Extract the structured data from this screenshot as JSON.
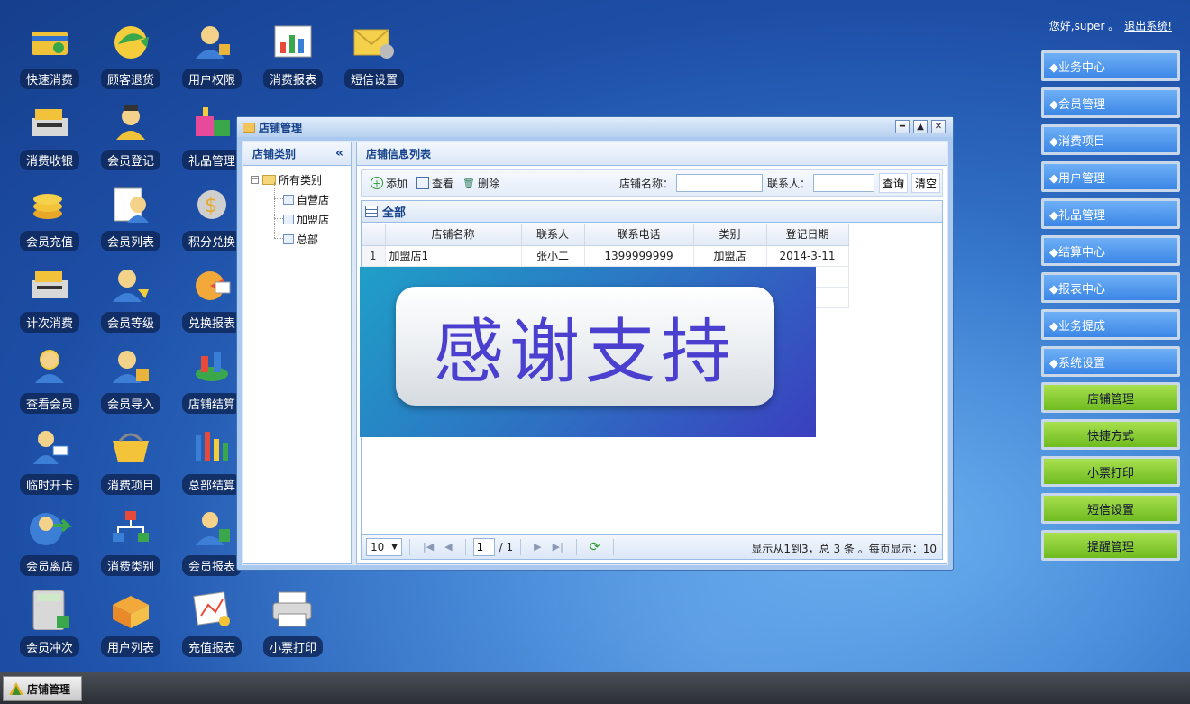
{
  "desktop_icons": [
    {
      "label": "快速消费",
      "icon": "quick-consume-icon"
    },
    {
      "label": "顾客退货",
      "icon": "return-icon"
    },
    {
      "label": "用户权限",
      "icon": "user-permission-icon"
    },
    {
      "label": "消费报表",
      "icon": "consume-report-icon"
    },
    {
      "label": "短信设置",
      "icon": "sms-settings-icon"
    },
    {
      "label": "消费收银",
      "icon": "cashier-icon"
    },
    {
      "label": "会员登记",
      "icon": "member-register-icon"
    },
    {
      "label": "礼品管理",
      "icon": "gift-icon"
    },
    {
      "label": "会员充值",
      "icon": "member-recharge-icon"
    },
    {
      "label": "会员列表",
      "icon": "member-list-icon"
    },
    {
      "label": "积分兑换",
      "icon": "points-exchange-icon"
    },
    {
      "label": "计次消费",
      "icon": "count-consume-icon"
    },
    {
      "label": "会员等级",
      "icon": "member-level-icon"
    },
    {
      "label": "兑换报表",
      "icon": "exchange-report-icon"
    },
    {
      "label": "查看会员",
      "icon": "view-member-icon"
    },
    {
      "label": "会员导入",
      "icon": "member-import-icon"
    },
    {
      "label": "店铺结算",
      "icon": "store-settle-icon"
    },
    {
      "label": "临时开卡",
      "icon": "temp-card-icon"
    },
    {
      "label": "消费项目",
      "icon": "consume-item-icon"
    },
    {
      "label": "总部结算",
      "icon": "hq-settle-icon"
    },
    {
      "label": "会员离店",
      "icon": "member-leave-icon"
    },
    {
      "label": "消费类别",
      "icon": "consume-category-icon"
    },
    {
      "label": "会员报表",
      "icon": "member-report-icon"
    },
    {
      "label": "会员冲次",
      "icon": "member-offset-icon"
    },
    {
      "label": "用户列表",
      "icon": "user-list-icon"
    },
    {
      "label": "充值报表",
      "icon": "recharge-report-icon"
    },
    {
      "label": "小票打印",
      "icon": "receipt-print-icon"
    }
  ],
  "header": {
    "greeting": "您好,super 。",
    "logout": "退出系统!"
  },
  "side_menu_blue": [
    "◆业务中心",
    "◆会员管理",
    "◆消费项目",
    "◆用户管理",
    "◆礼品管理",
    "◆结算中心",
    "◆报表中心",
    "◆业务提成",
    "◆系统设置"
  ],
  "side_menu_green": [
    "店铺管理",
    "快捷方式",
    "小票打印",
    "短信设置",
    "提醒管理"
  ],
  "window": {
    "title": "店铺管理",
    "tree_title": "店铺类别",
    "collapse": "«",
    "tree": {
      "root": "所有类别",
      "children": [
        "自营店",
        "加盟店",
        "总部"
      ]
    },
    "list_title": "店铺信息列表",
    "toolbar": {
      "add": "添加",
      "view": "查看",
      "delete": "删除",
      "name_label": "店铺名称：",
      "name_value": "",
      "contact_label": "联系人：",
      "contact_value": "",
      "search": "查询",
      "clear": "清空"
    },
    "grid_title": "全部",
    "columns": [
      "店铺名称",
      "联系人",
      "联系电话",
      "类别",
      "登记日期"
    ],
    "rows": [
      {
        "n": "1",
        "name": "加盟店1",
        "contact": "张小二",
        "phone": "1399999999",
        "type": "加盟店",
        "date": "2014-3-11"
      },
      {
        "n": "",
        "name": "",
        "contact": "",
        "phone": "",
        "type": "",
        "date": "-11"
      },
      {
        "n": "",
        "name": "",
        "contact": "",
        "phone": "",
        "type": "",
        "date": "/24"
      }
    ],
    "pager": {
      "page_size": "10",
      "page": "1",
      "total_pages": "/ 1",
      "info": "显示从1到3，总 3 条 。每页显示：10"
    }
  },
  "banner": {
    "text": "感谢支持"
  },
  "taskbar": {
    "button": "店铺管理"
  }
}
